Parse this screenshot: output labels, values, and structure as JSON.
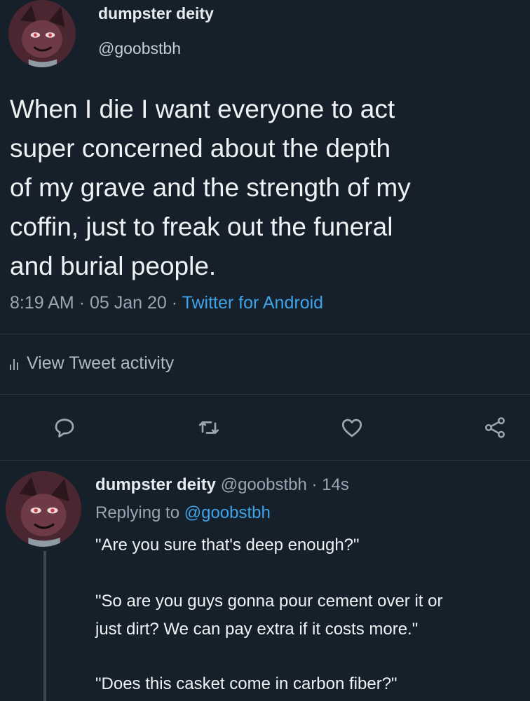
{
  "tweet": {
    "author_name": "dumpster deity",
    "author_handle": "@goobstbh",
    "text_lines": [
      "When I die I want everyone to act",
      "super concerned about the depth",
      "of my grave and the strength of my",
      "coffin, just to freak out the funeral",
      "and burial people."
    ],
    "time": "8:19 AM",
    "date": "05 Jan 20",
    "separator": "·",
    "source": "Twitter for Android",
    "activity_label": "View Tweet activity"
  },
  "actions": {
    "reply_icon": "reply-icon",
    "retweet_icon": "retweet-icon",
    "like_icon": "heart-icon",
    "share_icon": "share-icon"
  },
  "reply": {
    "author_name": "dumpster deity",
    "author_handle": "@goobstbh",
    "separator": "·",
    "age": "14s",
    "replying_prefix": "Replying to",
    "replying_to": "@goobstbh",
    "lines": [
      "\"Are you sure that's deep enough?\"",
      "\"So are you guys gonna pour cement over it or",
      "just dirt? We can pay extra if it costs more.\"",
      "\"Does this casket come in carbon fiber?\""
    ]
  },
  "colors": {
    "background": "#15202b",
    "text": "#e7ecf0",
    "muted": "#9aa6b1",
    "accent": "#3fa3ea"
  }
}
